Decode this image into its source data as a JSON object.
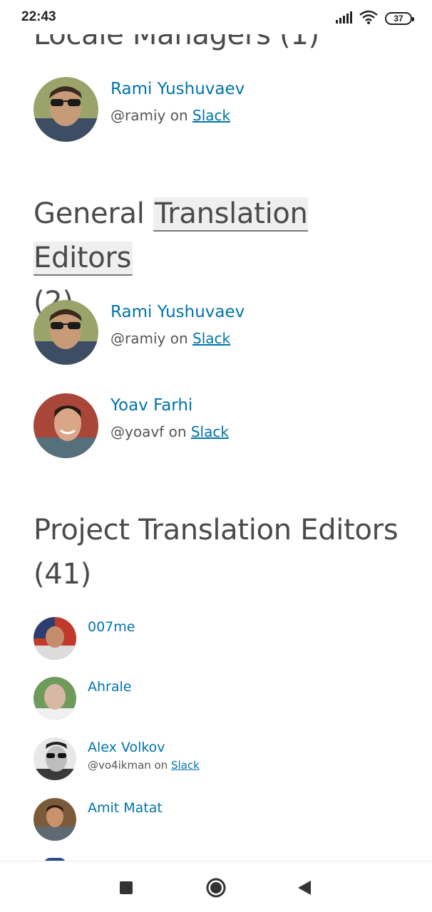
{
  "status": {
    "time": "22:43",
    "battery": "37"
  },
  "sections": {
    "locale_managers": {
      "title": "Locale Managers (1)"
    },
    "general_editors": {
      "title_plain": "General ",
      "title_highlight": "Translation Editors",
      "title_count": "(2)"
    },
    "project_editors": {
      "title": "Project Translation Editors (41)"
    }
  },
  "locale_managers": [
    {
      "name": "Rami Yushuvaev",
      "handle": "@ramiy",
      "on": "on",
      "slack": "Slack"
    }
  ],
  "general_editors": [
    {
      "name": "Rami Yushuvaev",
      "handle": "@ramiy",
      "on": "on",
      "slack": "Slack"
    },
    {
      "name": "Yoav Farhi",
      "handle": "@yoavf",
      "on": "on",
      "slack": "Slack"
    }
  ],
  "project_editors": [
    {
      "name": "007me"
    },
    {
      "name": "Ahrale"
    },
    {
      "name": "Alex Volkov",
      "handle": "@vo4ikman",
      "on": "on",
      "slack": "Slack"
    },
    {
      "name": "Amit Matat"
    }
  ]
}
